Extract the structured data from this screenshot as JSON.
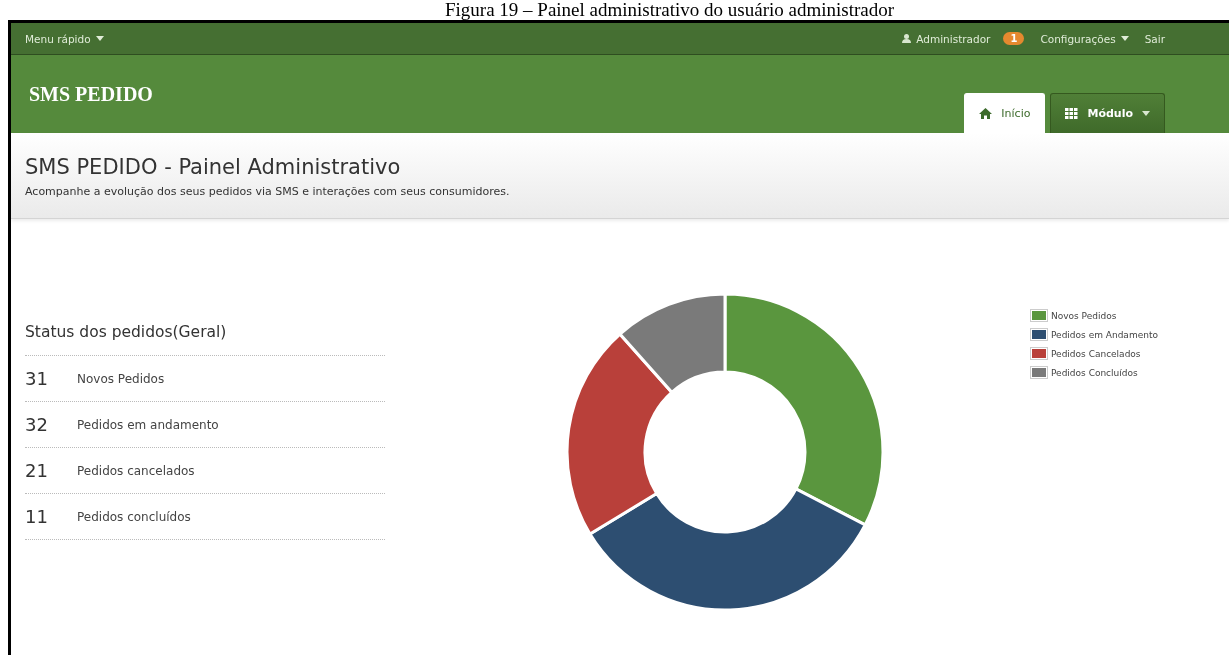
{
  "caption": "Figura 19 – Painel administrativo do usuário administrador",
  "topbar": {
    "menu": "Menu rápido",
    "user": "Administrador",
    "badge": "1",
    "settings": "Configurações",
    "logout": "Sair"
  },
  "brand": "SMS PEDIDO",
  "tabs": [
    {
      "label": "Início",
      "selected": true
    },
    {
      "label": "Módulo",
      "selected": false
    }
  ],
  "page": {
    "title": "SMS PEDIDO - Painel Administrativo",
    "subtitle": "Acompanhe a evolução dos seus pedidos via SMS e interações com seus consumidores."
  },
  "status": {
    "title": "Status dos pedidos(Geral)",
    "items": [
      {
        "count": "31",
        "label": "Novos Pedidos"
      },
      {
        "count": "32",
        "label": "Pedidos em andamento"
      },
      {
        "count": "21",
        "label": "Pedidos cancelados"
      },
      {
        "count": "11",
        "label": "Pedidos concluídos"
      }
    ]
  },
  "chart_data": {
    "type": "donut",
    "categories": [
      "Novos Pedidos",
      "Pedidos em Andamento",
      "Pedidos Cancelados",
      "Pedidos Concluídos"
    ],
    "values": [
      32.63,
      33.68,
      22.11,
      11.58
    ],
    "colors": [
      "#5a963e",
      "#2d4e71",
      "#b9403a",
      "#7a7a7a"
    ]
  }
}
